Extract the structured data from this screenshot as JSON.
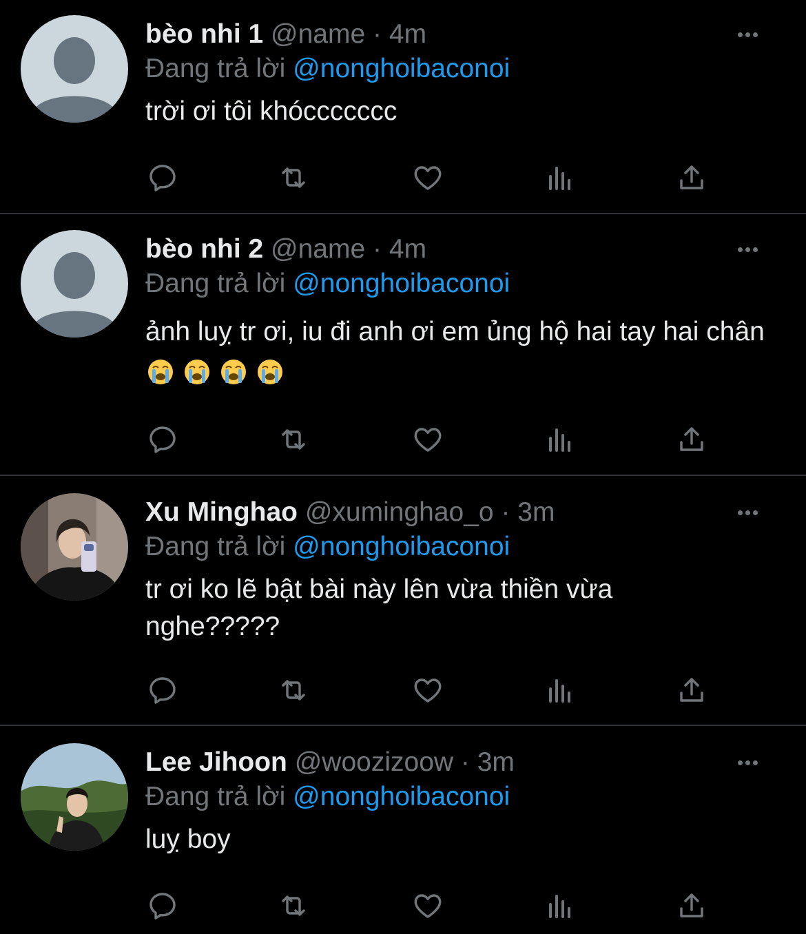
{
  "colors": {
    "background": "#000000",
    "name": "#e7e9ea",
    "meta": "#71767b",
    "mention": "#1d9bf0",
    "divider": "#2f3336"
  },
  "tweets": [
    {
      "name": "bèo nhi 1",
      "handle": "@name",
      "sep": "·",
      "time": "4m",
      "replying_prefix": "Đang trả lời",
      "replying_to": "@nonghoibaconoi",
      "text": "trời ơi tôi khóccccccc",
      "avatar": "default-avatar"
    },
    {
      "name": "bèo nhi 2",
      "handle": "@name",
      "sep": "·",
      "time": "4m",
      "replying_prefix": "Đang trả lời",
      "replying_to": "@nonghoibaconoi",
      "text": "ảnh luỵ tr ơi, iu đi anh ơi em ủng hộ hai tay hai chân",
      "emojis": [
        "loudly-crying-face",
        "loudly-crying-face",
        "loudly-crying-face",
        "loudly-crying-face"
      ],
      "avatar": "default-avatar"
    },
    {
      "name": "Xu Minghao",
      "handle": "@xuminghao_o",
      "sep": "·",
      "time": "3m",
      "replying_prefix": "Đang trả lời",
      "replying_to": "@nonghoibaconoi",
      "text": "tr ơi ko lẽ bật bài này lên vừa thiền vừa nghe?????",
      "avatar": "photo-avatar"
    },
    {
      "name": "Lee Jihoon",
      "handle": "@woozizoow",
      "sep": "·",
      "time": "3m",
      "replying_prefix": "Đang trả lời",
      "replying_to": "@nonghoibaconoi",
      "text": "luỵ boy",
      "avatar": "photo-avatar"
    }
  ],
  "actions": [
    "reply-icon",
    "retweet-icon",
    "like-icon",
    "views-icon",
    "share-icon"
  ]
}
